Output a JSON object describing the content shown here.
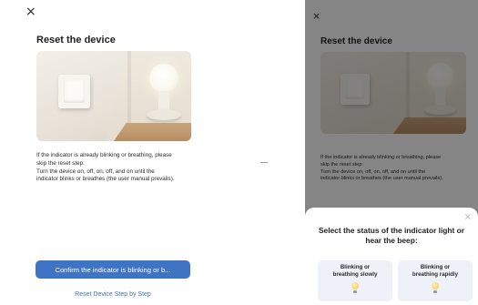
{
  "reset_screen": {
    "close_icon": "×",
    "title": "Reset the device",
    "illustration": {
      "description_icon": "light-switch-and-bulb-illustration"
    },
    "instructions": [
      "If the indicator is already blinking or breathing, please",
      "skip the reset step:",
      "Turn the device on, off, on, off, and on until the",
      "indicator blinks or breathes (the user manual prevails)."
    ],
    "confirm_button": "Confirm the indicator is blinking or b...",
    "step_link": "Reset Device Step by Step"
  },
  "separator": "–",
  "status_sheet": {
    "close_icon": "×",
    "title": "Select the status of the indicator light or hear the beep:",
    "options": [
      {
        "label_line1": "Blinking or",
        "label_line2": "breathing slowly",
        "icon": "lightbulb-icon"
      },
      {
        "label_line1": "Blinking or",
        "label_line2": "breathing rapidly",
        "icon": "lightbulb-icon"
      }
    ]
  },
  "colors": {
    "accent": "#3f73c4",
    "overlay": "rgba(0,0,0,0.48)",
    "card": "#eef2f8"
  }
}
